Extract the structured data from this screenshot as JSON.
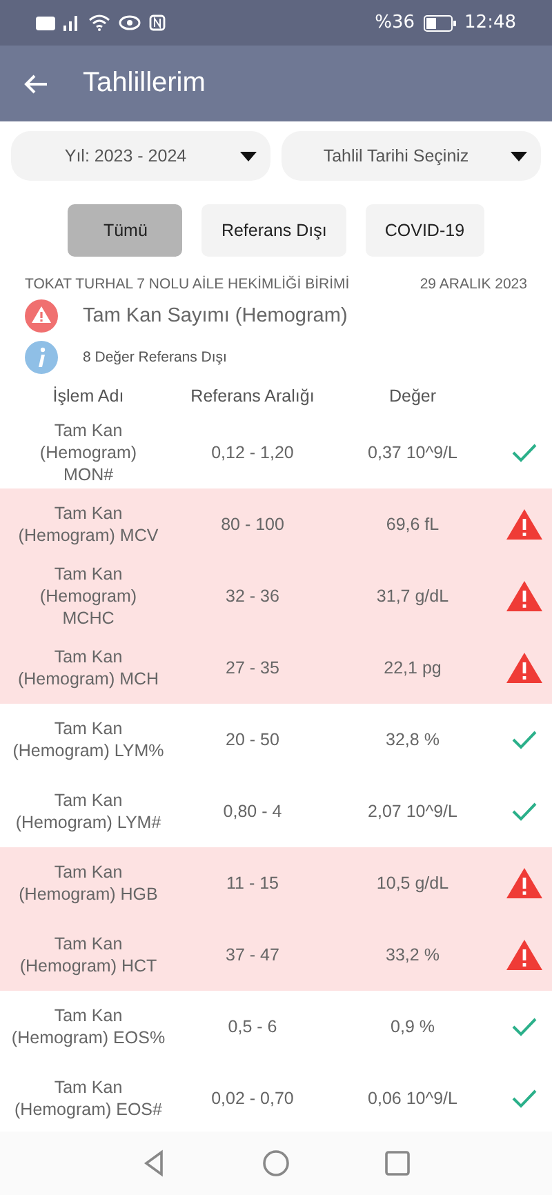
{
  "status_bar": {
    "battery_percent": "%36",
    "time": "12:48"
  },
  "app_bar": {
    "title": "Tahlillerim"
  },
  "dropdowns": [
    {
      "value": "Yıl: 2023 - 2024"
    },
    {
      "value": "Tahlil Tarihi Seçiniz"
    }
  ],
  "filters": [
    {
      "label": "Tümü",
      "selected": true
    },
    {
      "label": "Referans Dışı",
      "selected": false
    },
    {
      "label": "COVID-19",
      "selected": false
    }
  ],
  "report": {
    "institution": "TOKAT TURHAL 7 NOLU AİLE HEKİMLİĞİ BİRİMİ",
    "date": "29 ARALIK 2023",
    "test_name": "Tam Kan Sayımı (Hemogram)",
    "summary": "8 Değer Referans Dışı"
  },
  "table": {
    "columns": [
      "İşlem Adı",
      "Referans Aralığı",
      "Değer"
    ],
    "rows": [
      {
        "name": "Tam Kan\n(Hemogram)\nMON#",
        "range": "0,12 - 1,20",
        "value": "0,37 10^9/L",
        "out_of_range": false
      },
      {
        "name": "Tam Kan\n(Hemogram)  MCV",
        "range": "80 - 100",
        "value": "69,6 fL",
        "out_of_range": true
      },
      {
        "name": "Tam Kan\n(Hemogram)\nMCHC",
        "range": "32 - 36",
        "value": "31,7 g/dL",
        "out_of_range": true
      },
      {
        "name": "Tam Kan\n(Hemogram)  MCH",
        "range": "27 - 35",
        "value": "22,1 pg",
        "out_of_range": true
      },
      {
        "name": "Tam Kan\n(Hemogram)  LYM%",
        "range": "20 - 50",
        "value": "32,8 %",
        "out_of_range": false
      },
      {
        "name": "Tam Kan\n(Hemogram)  LYM#",
        "range": "0,80 - 4",
        "value": "2,07 10^9/L",
        "out_of_range": false
      },
      {
        "name": "Tam Kan\n(Hemogram)  HGB",
        "range": "11 - 15",
        "value": "10,5 g/dL",
        "out_of_range": true
      },
      {
        "name": "Tam Kan\n(Hemogram)  HCT",
        "range": "37 - 47",
        "value": "33,2 %",
        "out_of_range": true
      },
      {
        "name": "Tam Kan\n(Hemogram)  EOS%",
        "range": "0,5 - 6",
        "value": "0,9 %",
        "out_of_range": false
      },
      {
        "name": "Tam Kan\n(Hemogram)  EOS#",
        "range": "0,02 - 0,70",
        "value": "0,06 10^9/L",
        "out_of_range": false
      }
    ]
  }
}
